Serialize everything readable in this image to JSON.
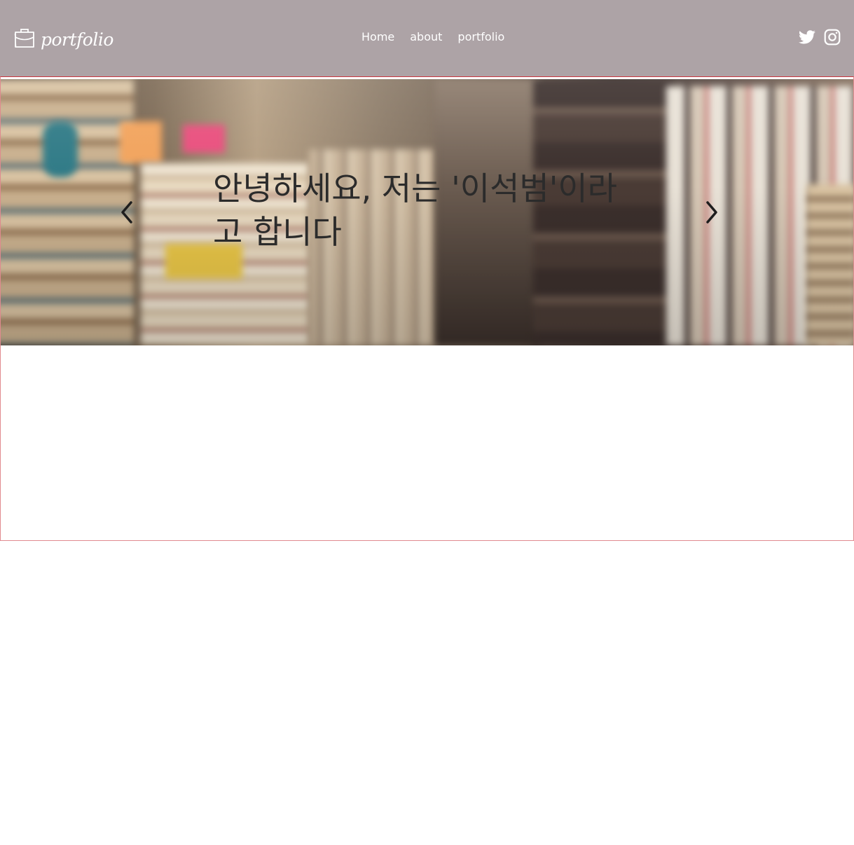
{
  "header": {
    "logo_text": "portfolio",
    "nav": [
      "Home",
      "about",
      "portfolio"
    ],
    "social": [
      "twitter-icon",
      "instagram-icon"
    ],
    "background": "#ada3a6"
  },
  "hero": {
    "title": "안녕하세요, 저는 '이석범'이라고 합니다",
    "prev_icon": "chevron-left-icon",
    "next_icon": "chevron-right-icon"
  },
  "colors": {
    "frame_border": "#e08a8f",
    "title_text": "#2b2b2b"
  }
}
